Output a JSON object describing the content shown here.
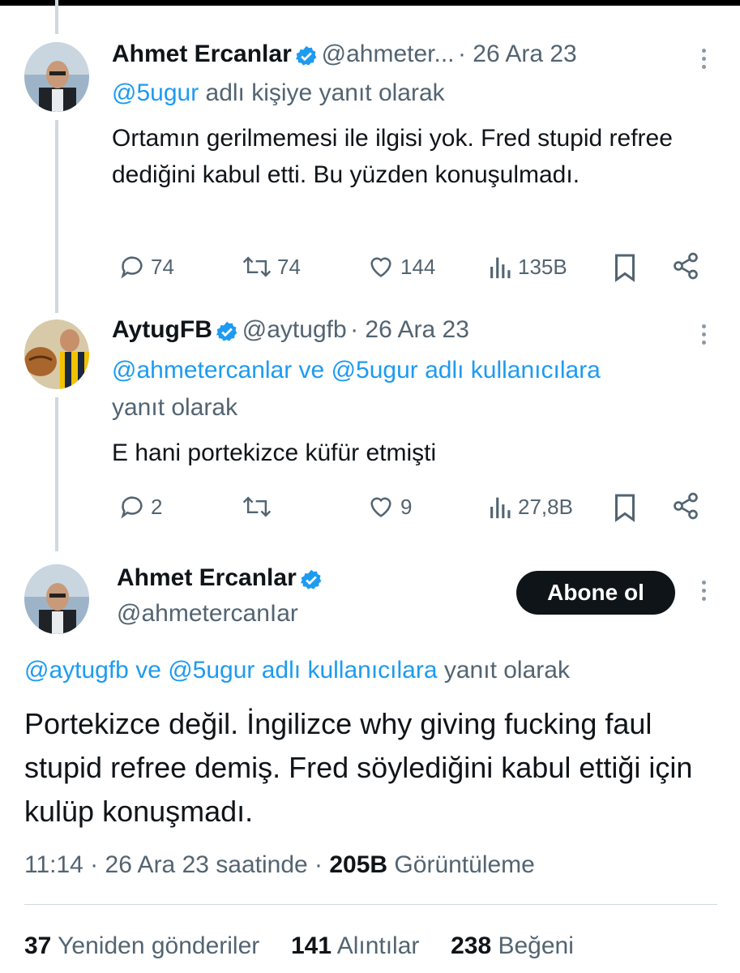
{
  "tweets": [
    {
      "name": "Ahmet Ercanlar",
      "handle": "@ahmeter...",
      "date": "· 26 Ara 23",
      "reply_handles": "@5ugur",
      "reply_suffix": " adlı kişiye yanıt olarak",
      "text": "Ortamın gerilmemesi ile ilgisi yok. Fred stupid refree dediğini kabul etti. Bu yüzden konuşulmadı.",
      "replies": "74",
      "retweets": "74",
      "likes": "144",
      "views": "135B"
    },
    {
      "name": "AytugFB",
      "handle": "@aytugfb",
      "date": "· 26 Ara 23",
      "reply_handles": "@ahmetercanlar ve @5ugur adlı kullanıcılara",
      "reply_suffix": "yanıt olarak",
      "text": "E hani portekizce küfür etmişti",
      "replies": "2",
      "retweets": "",
      "likes": "9",
      "views": "27,8B"
    }
  ],
  "main_tweet": {
    "name": "Ahmet Ercanlar",
    "handle": "@ahmetercanIar",
    "follow_label": "Abone ol",
    "reply_handles": "@aytugfb ve @5ugur adlı kullanıcılara",
    "reply_suffix": " yanıt olarak",
    "text": "Portekizce değil. İngilizce why giving fucking faul stupid refree demiş. Fred söylediğini kabul ettiği için kulüp konuşmadı.",
    "time": "11:14 · 26 Ara 23 saatinde · ",
    "views_count": "205B",
    "views_label": " Görüntüleme",
    "stats": {
      "reposts_count": "37",
      "reposts_label": " Yeniden gönderiler",
      "quotes_count": "141",
      "quotes_label": " Alıntılar",
      "likes_count": "238",
      "likes_label": " Beğeni"
    }
  },
  "colors": {
    "link": "#1d9bf0",
    "muted": "#536471",
    "text": "#0f1419",
    "verified": "#1d9bf0"
  }
}
